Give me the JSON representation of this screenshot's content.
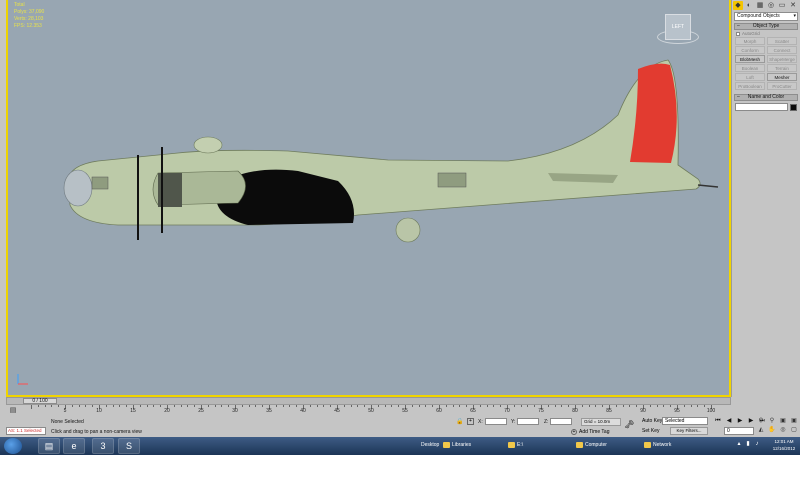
{
  "viewport": {
    "stats": [
      "Total",
      "Polys: 37,090",
      "Verts: 28,103",
      "",
      "FPS: 12.353"
    ],
    "viewcube_label": "LEFT"
  },
  "command_panel": {
    "tabs": [
      "create-tab",
      "modify-tab",
      "hierarchy-tab",
      "motion-tab",
      "display-tab",
      "utilities-tab"
    ],
    "category": "Compound Objects",
    "object_type_title": "Object Type",
    "autogrid_label": "AutoGrid",
    "buttons": [
      {
        "label": "Morph",
        "enabled": false
      },
      {
        "label": "Scatter",
        "enabled": false
      },
      {
        "label": "Conform",
        "enabled": false
      },
      {
        "label": "Connect",
        "enabled": false
      },
      {
        "label": "BlobMesh",
        "enabled": true
      },
      {
        "label": "ShapeMerge",
        "enabled": false
      },
      {
        "label": "Boolean",
        "enabled": false
      },
      {
        "label": "Terrain",
        "enabled": false
      },
      {
        "label": "Loft",
        "enabled": false
      },
      {
        "label": "Mesher",
        "enabled": true
      },
      {
        "label": "ProBoolean",
        "enabled": false
      },
      {
        "label": "ProCutter",
        "enabled": false
      }
    ],
    "name_color_title": "Name and Color",
    "object_name": "",
    "object_color": "#0b0b0b"
  },
  "timeline": {
    "slider_label": "0 / 100",
    "ticks": [
      "5",
      "10",
      "15",
      "20",
      "25",
      "30",
      "35",
      "40",
      "45",
      "50",
      "55",
      "60",
      "65",
      "70",
      "75",
      "80",
      "85",
      "90",
      "95",
      "100"
    ]
  },
  "status": {
    "maxscript": "AS: 1.1 Selected",
    "selection": "None Selected",
    "prompt": "Click and drag to pan a non-camera view",
    "x_label": "X:",
    "y_label": "Y:",
    "z_label": "Z:",
    "grid": "Grid = 10.0m",
    "add_time_tag": "Add Time Tag",
    "auto_key": "Auto Key",
    "set_key": "Set Key",
    "selected_dropdown": "Selected",
    "key_filters": "Key Filters...",
    "current_frame": "0"
  },
  "taskbar": {
    "pinned": [
      "explorer-icon",
      "ie-icon",
      "3dsmax-icon",
      "skype-icon"
    ],
    "desktop_label": "Desktop",
    "libraries_label": "Libraries",
    "drive_label": "E:\\",
    "computer_label": "Computer",
    "network_label": "Network",
    "time": "12:01 AM",
    "date": "12/16/2012"
  },
  "colors": {
    "viewport_bg": "#98a6b2",
    "aircraft_body": "#bccaa8",
    "tail_stripe": "#e23b30",
    "active_border": "#f0d400"
  }
}
